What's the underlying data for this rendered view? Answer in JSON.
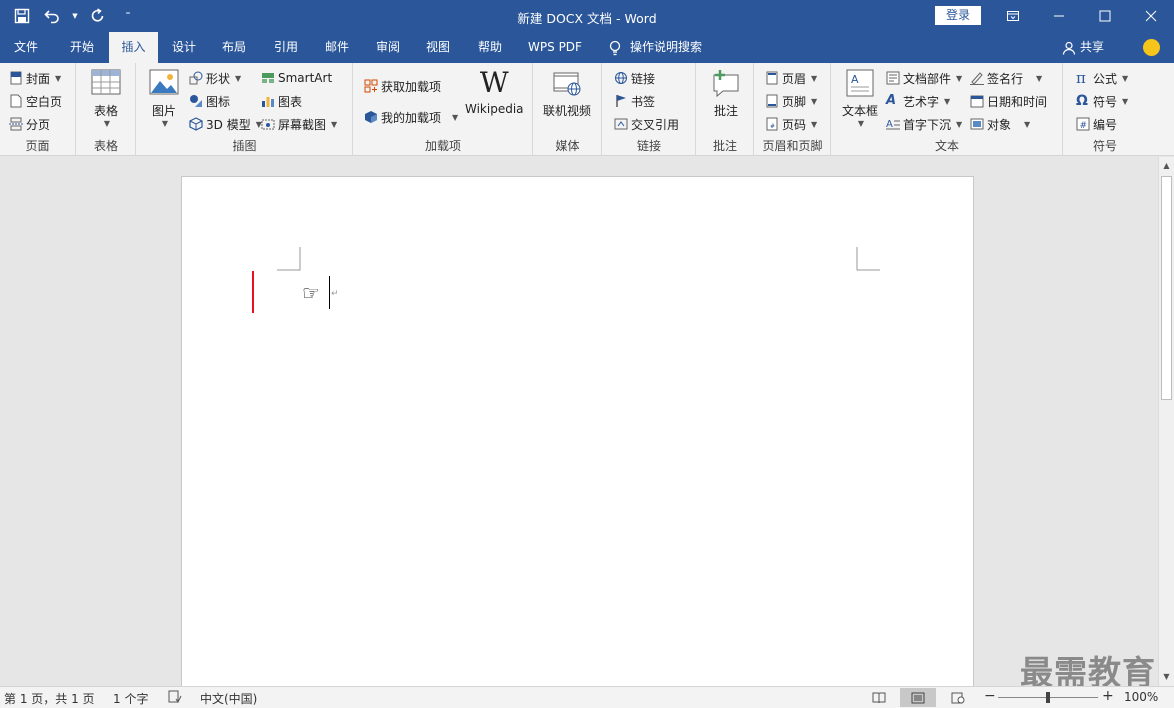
{
  "window": {
    "title": "新建 DOCX 文档 - Word",
    "login_label": "登录"
  },
  "qat": {
    "save_icon": "save-icon",
    "undo_icon": "undo-icon",
    "redo_icon": "redo-icon",
    "customize_icon": "customize-qat-icon"
  },
  "tabs": [
    {
      "label": "文件"
    },
    {
      "label": "开始"
    },
    {
      "label": "插入"
    },
    {
      "label": "设计"
    },
    {
      "label": "布局"
    },
    {
      "label": "引用"
    },
    {
      "label": "邮件"
    },
    {
      "label": "审阅"
    },
    {
      "label": "视图"
    },
    {
      "label": "帮助"
    },
    {
      "label": "WPS PDF"
    }
  ],
  "active_tab": "插入",
  "tell_me": "操作说明搜索",
  "share_label": "共享",
  "ribbon": {
    "pages": {
      "label": "页面",
      "items": [
        "封面",
        "空白页",
        "分页"
      ]
    },
    "tables": {
      "label": "表格",
      "table": "表格"
    },
    "illustrations": {
      "label": "插图",
      "picture": "图片",
      "shapes": "形状",
      "icons": "图标",
      "model3d": "3D 模型",
      "smartart": "SmartArt",
      "chart": "图表",
      "screenshot": "屏幕截图"
    },
    "addins": {
      "label": "加载项",
      "get": "获取加载项",
      "mine": "我的加载项",
      "wikipedia": "Wikipedia",
      "wiki_glyph": "W"
    },
    "media": {
      "label": "媒体",
      "video": "联机视频"
    },
    "links": {
      "label": "链接",
      "link": "链接",
      "bookmark": "书签",
      "crossref": "交叉引用"
    },
    "comments": {
      "label": "批注",
      "comment": "批注"
    },
    "header_footer": {
      "label": "页眉和页脚",
      "header": "页眉",
      "footer": "页脚",
      "page_number": "页码"
    },
    "text": {
      "label": "文本",
      "textbox": "文本框",
      "quickparts": "文档部件",
      "wordart": "艺术字",
      "dropcap": "首字下沉",
      "signature": "签名行",
      "datetime": "日期和时间",
      "object": "对象"
    },
    "symbols": {
      "label": "符号",
      "equation": "公式",
      "symbol": "符号",
      "number": "编号",
      "pi": "π",
      "omega": "Ω"
    }
  },
  "document": {
    "pointer_glyph": "☞",
    "paragraph_mark": "↵"
  },
  "watermark": "最需教育",
  "status": {
    "page": "第 1 页，共 1 页",
    "words": "1 个字",
    "language": "中文(中国)",
    "zoom": "100%",
    "zoom_minus": "−",
    "zoom_plus": "+"
  }
}
